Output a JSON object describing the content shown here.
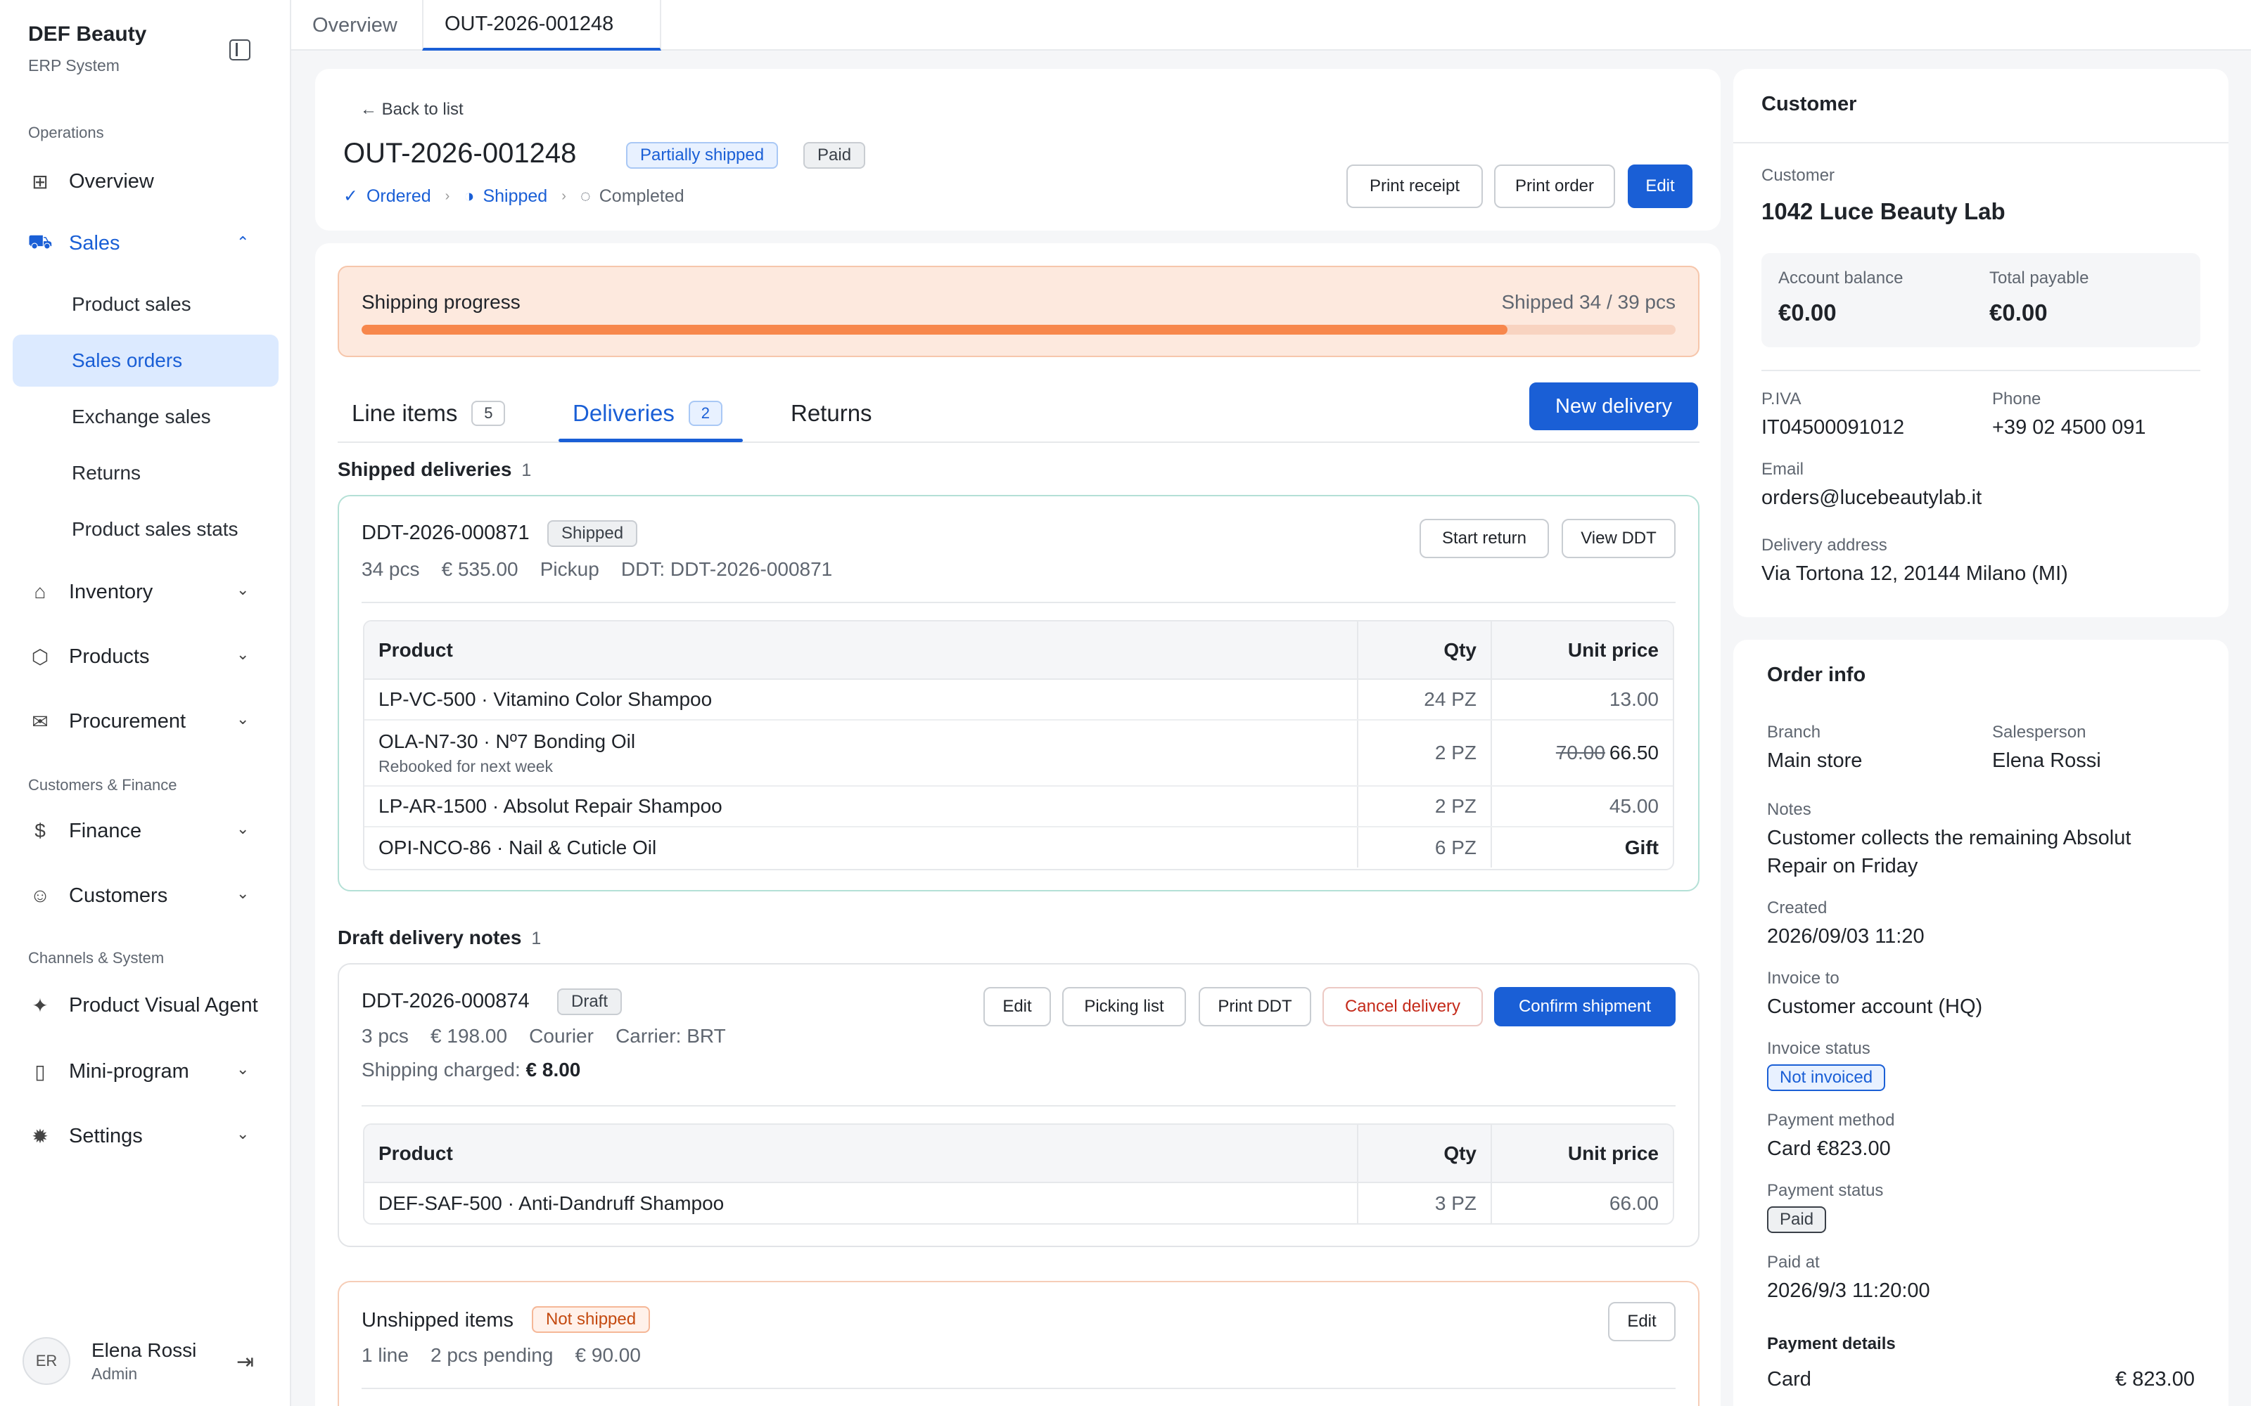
{
  "sidebar": {
    "company": "DEF Beauty",
    "system": "ERP System",
    "sections": [
      "Operations",
      "Customers & Finance",
      "Channels & System"
    ],
    "nav": {
      "overview": "Overview",
      "sales": "Sales",
      "inventory": "Inventory",
      "products": "Products",
      "procurement": "Procurement",
      "finance": "Finance",
      "customers": "Customers",
      "visual_agent": "Product Visual Agent",
      "mini_program": "Mini-program",
      "settings": "Settings"
    },
    "sales_sub": [
      "Product sales",
      "Sales orders",
      "Exchange sales",
      "Returns",
      "Product sales stats"
    ],
    "user": {
      "initials": "ER",
      "name": "Elena Rossi",
      "role": "Admin"
    }
  },
  "tabs": [
    "Overview",
    "OUT-2026-001248"
  ],
  "order": {
    "back": "← Back to list",
    "number": "OUT-2026-001248",
    "status_badge": "Partially shipped",
    "pay_badge": "Paid",
    "steps": [
      "Ordered",
      "Shipped",
      "Completed"
    ],
    "actions": {
      "print_receipt": "Print receipt",
      "print_order": "Print order",
      "edit": "Edit"
    }
  },
  "progress": {
    "label": "Shipping progress",
    "value": "Shipped 34 / 39 pcs",
    "shipped": 34,
    "total": 39
  },
  "content_tabs": {
    "line_items": "Line items",
    "line_items_count": "5",
    "deliveries": "Deliveries",
    "deliveries_count": "2",
    "returns": "Returns",
    "new_delivery": "New delivery"
  },
  "shipped": {
    "title": "Shipped deliveries",
    "count": "1",
    "ddt": "DDT-2026-000871",
    "badge": "Shipped",
    "meta": "34 pcs    € 535.00    Pickup    DDT: DDT-2026-000871",
    "start_return": "Start return",
    "view_ddt": "View DDT",
    "headers": {
      "product": "Product",
      "qty": "Qty",
      "price": "Unit price"
    },
    "rows": [
      {
        "product": "LP-VC-500 · Vitamino Color Shampoo",
        "qty": "24 PZ",
        "price": "13.00"
      },
      {
        "product": "OLA-N7-30 · Nº7 Bonding Oil",
        "note": "Rebooked for next week",
        "qty": "2 PZ",
        "old_price": "70.00",
        "price": "66.50"
      },
      {
        "product": "LP-AR-1500 · Absolut Repair Shampoo",
        "qty": "2 PZ",
        "price": "45.00"
      },
      {
        "product": "OPI-NCO-86 · Nail & Cuticle Oil",
        "qty": "6 PZ",
        "price": "Gift"
      }
    ]
  },
  "draft": {
    "title": "Draft delivery notes",
    "count": "1",
    "ddt": "DDT-2026-000874",
    "badge": "Draft",
    "meta": "3 pcs    € 198.00    Courier    Carrier: BRT",
    "shipping_label": "Shipping charged: ",
    "shipping_value": "€ 8.00",
    "actions": {
      "edit": "Edit",
      "picking": "Picking list",
      "print": "Print DDT",
      "cancel": "Cancel delivery",
      "confirm": "Confirm shipment"
    },
    "headers": {
      "product": "Product",
      "qty": "Qty",
      "price": "Unit price"
    },
    "rows": [
      {
        "product": "DEF-SAF-500 · Anti-Dandruff Shampoo",
        "qty": "3 PZ",
        "price": "66.00"
      }
    ]
  },
  "unshipped": {
    "title": "Unshipped items",
    "badge": "Not shipped",
    "meta": "1 line    2 pcs pending    € 90.00",
    "edit": "Edit"
  },
  "customer": {
    "header": "Customer",
    "label": "Customer",
    "name": "1042 Luce Beauty Lab",
    "balance_label": "Account balance",
    "balance": "€0.00",
    "payable_label": "Total payable",
    "payable": "€0.00",
    "piva_label": "P.IVA",
    "piva": "IT04500091012",
    "phone_label": "Phone",
    "phone": "+39 02 4500 091",
    "email_label": "Email",
    "email": "orders@lucebeautylab.it",
    "address_label": "Delivery address",
    "address": "Via Tortona 12, 20144 Milano (MI)"
  },
  "info": {
    "header": "Order info",
    "branch_label": "Branch",
    "branch": "Main store",
    "sales_label": "Salesperson",
    "salesperson": "Elena Rossi",
    "notes_label": "Notes",
    "notes1": "Customer collects the remaining Absolut",
    "notes2": "Repair on Friday",
    "created_label": "Created",
    "created": "2026/09/03 11:20",
    "invoice_to_label": "Invoice to",
    "invoice_to": "Customer account (HQ)",
    "invoice_status_label": "Invoice status",
    "invoice_status": "Not invoiced",
    "payment_method_label": "Payment method",
    "payment_method": "Card €823.00",
    "payment_status_label": "Payment status",
    "payment_status": "Paid",
    "paid_at_label": "Paid at",
    "paid_at": "2026/9/3 11:20:00",
    "details_label": "Payment details",
    "details_method": "Card",
    "details_amount": "€ 823.00"
  }
}
